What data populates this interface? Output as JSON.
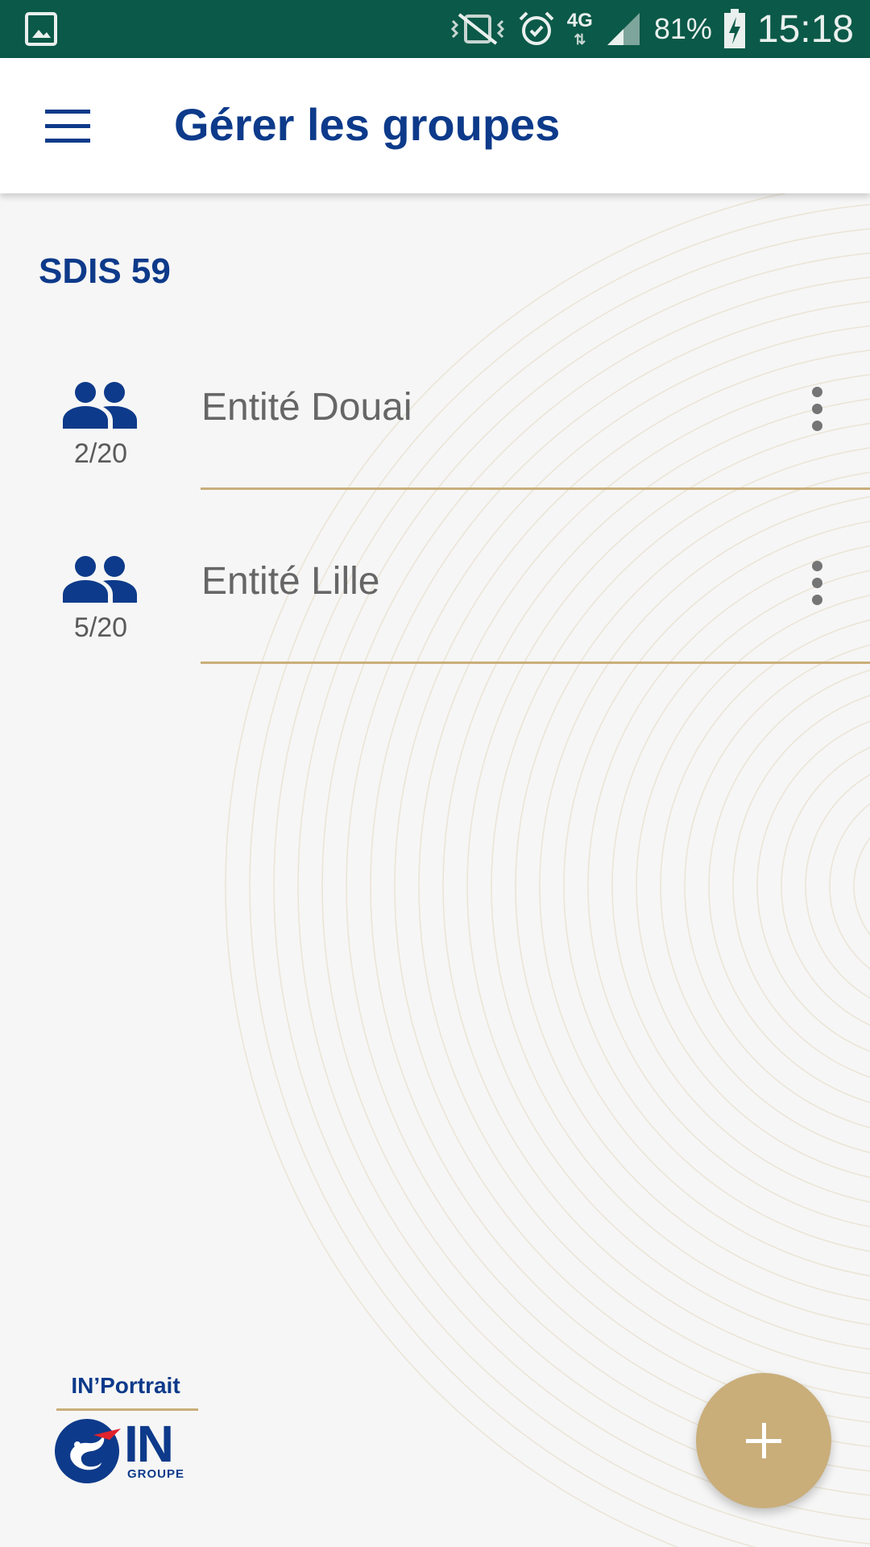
{
  "status_bar": {
    "left_icons": [
      "gallery-notification-icon"
    ],
    "right_icons": [
      "vibrate-icon",
      "alarm-icon",
      "network-4g-icon",
      "signal-icon",
      "battery-charging-icon"
    ],
    "network_type": "4G",
    "network_arrows": "⇅",
    "battery_percent": "81%",
    "time": "15:18"
  },
  "app_bar": {
    "title": "Gérer les groupes",
    "menu_icon": "menu-icon"
  },
  "organization": {
    "name": "SDIS 59"
  },
  "groups": [
    {
      "name": "Entité Douai",
      "members": "2/20",
      "icon": "group-icon",
      "menu_icon": "more-vert-icon"
    },
    {
      "name": "Entité Lille",
      "members": "5/20",
      "icon": "group-icon",
      "menu_icon": "more-vert-icon"
    }
  ],
  "footer": {
    "app_name": "IN’Portrait",
    "brand_text": "IN",
    "brand_sub": "GROUPE"
  },
  "fab": {
    "icon": "add-icon"
  },
  "colors": {
    "status_bar": "#0b5948",
    "primary_blue": "#0d3a8a",
    "gold_accent": "#c9ae7a",
    "background": "#f6f6f6",
    "text_gray": "#666666"
  }
}
